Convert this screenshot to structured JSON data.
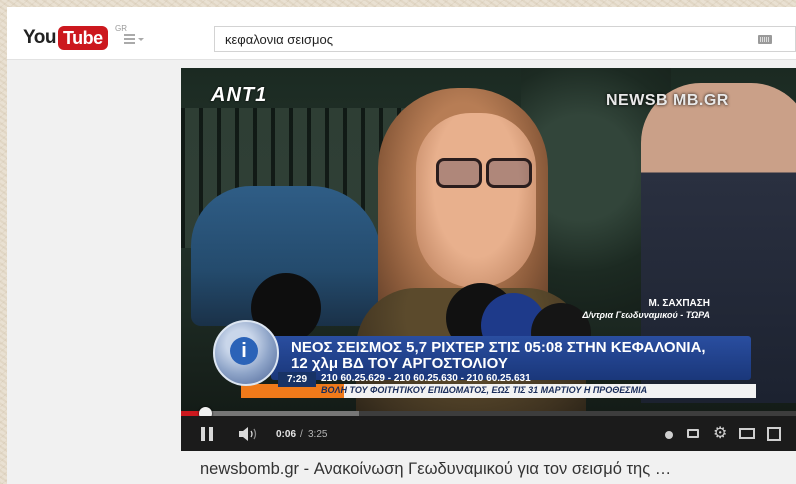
{
  "masthead": {
    "logo_you": "You",
    "logo_tube": "Tube",
    "region": "GR",
    "search_value": "κεφαλονια σεισμος"
  },
  "video_frame": {
    "channel_logo": "ANT1",
    "watermark": "NEWSB   MB.GR",
    "caption_name": "Μ. ΣΑΧΠΑΣΗ",
    "caption_role": "Δ/ντρια Γεωδυναμικού - ΤΩΡΑ",
    "headline_line1": "ΝΕΟΣ ΣΕΙΣΜΟΣ 5,7 ΡΙΧΤΕΡ ΣΤΙΣ 05:08 ΣΤΗΝ ΚΕΦΑΛΟΝΙΑ,",
    "headline_line2": "12 χλμ ΒΔ ΤΟΥ ΑΡΓΟΣΤΟΛΙΟΥ",
    "clock": "7:29",
    "phones": "210 60.25.629 - 210 60.25.630 - 210 60.25.631",
    "scroll_text": "ΒΟΛΗ ΤΟΥ ΦΟΙΤΗΤΙΚΟΥ ΕΠΙΔΟΜΑΤΟΣ, ΕΩΣ ΤΙΣ 31 ΜΑΡΤΙΟΥ Η ΠΡΟΘΕΣΜΙΑ",
    "badge_letter": "i"
  },
  "player": {
    "time_current": "0:06",
    "time_separator": "/",
    "time_total": "3:25",
    "played_fraction": 0.03,
    "loaded_fraction": 0.29
  },
  "video_title": "newsbomb.gr - Ανακοίνωση Γεωδυναμικού για τον σεισμό της …",
  "colors": {
    "brand_red": "#cc181e",
    "ticker_blue": "#2a4ea0",
    "ticker_orange": "#ef7a1a"
  }
}
